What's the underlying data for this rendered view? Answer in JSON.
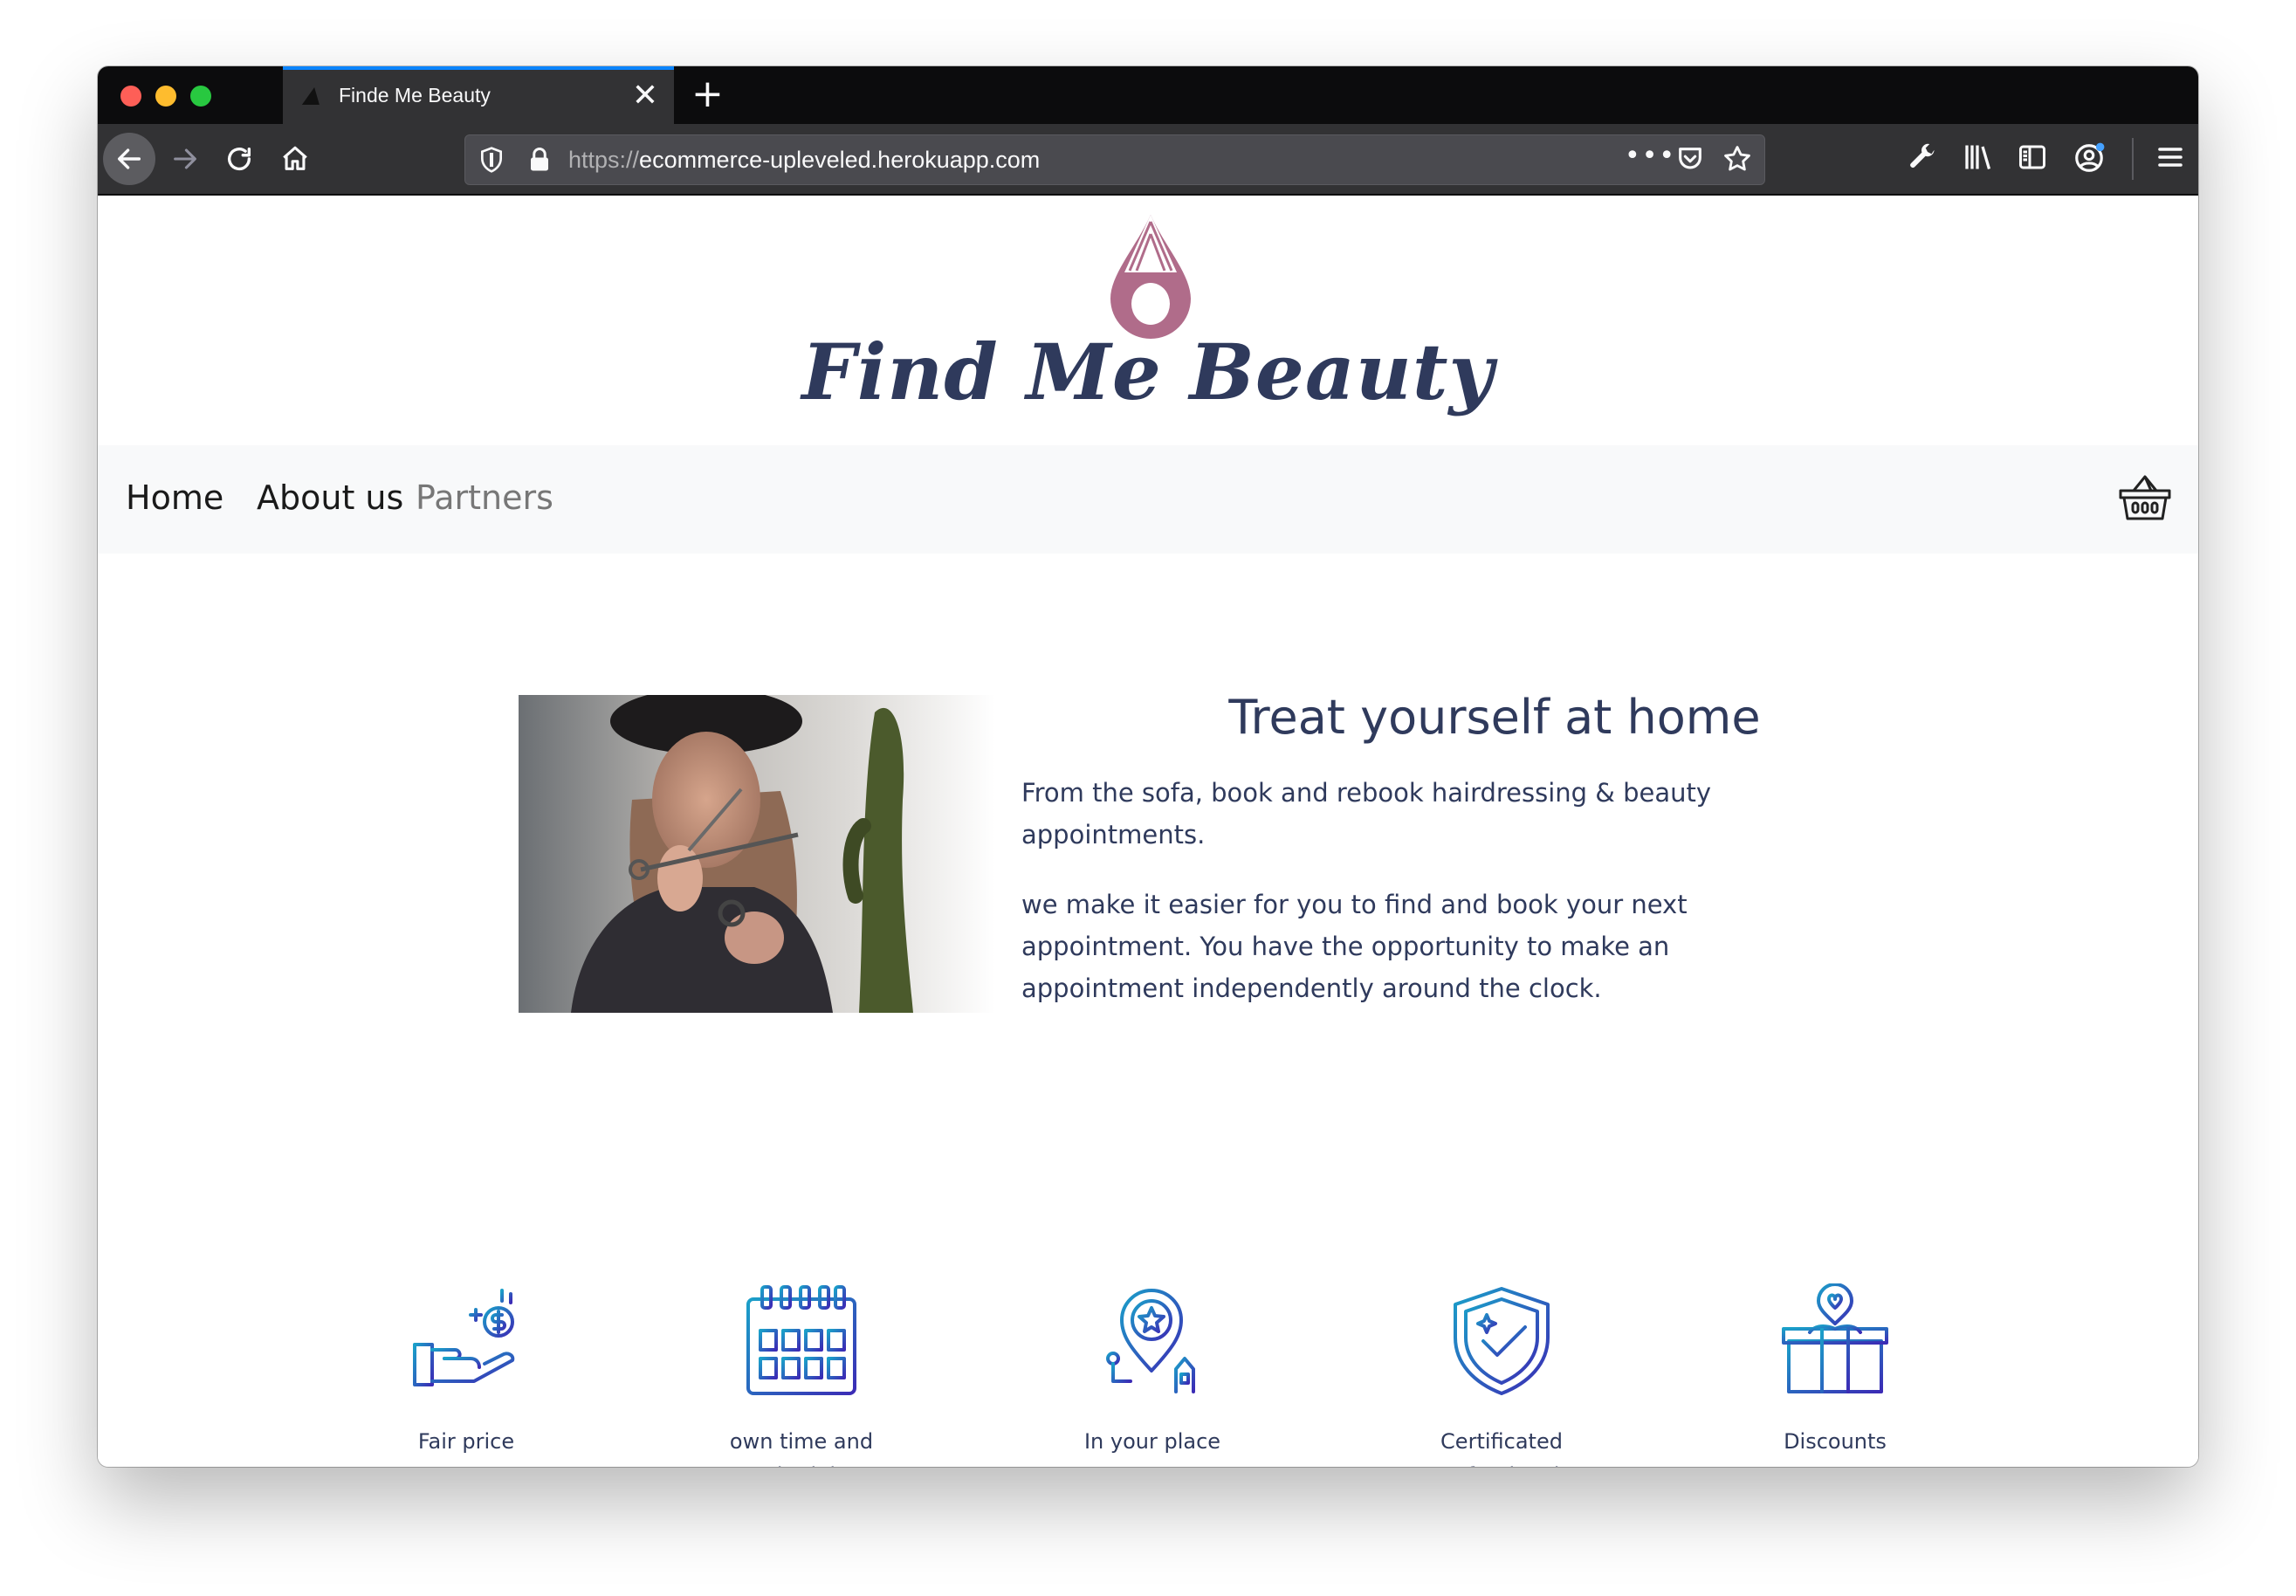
{
  "browser": {
    "tab_title": "Finde Me Beauty",
    "url_scheme": "https://",
    "url_host": "ecommerce-upleveled.herokuapp.com"
  },
  "site": {
    "brand": "Find Me Beauty",
    "accent_color": "#b06c8a",
    "text_color": "#2f3a5c",
    "icon_gradient": [
      "#1aa0c9",
      "#3b2bb5"
    ]
  },
  "nav": {
    "home": "Home",
    "about": "About us",
    "partners": "Partners"
  },
  "hero": {
    "title": "Treat yourself at home",
    "paragraph1": "From the sofa, book and rebook hairdressing & beauty appointments.",
    "paragraph2": "we make it easier for you to find and book your next appointment. You have the opportunity to make an appointment independently around the clock."
  },
  "features": [
    {
      "label": "Fair price",
      "icon": "hand-coin-icon"
    },
    {
      "label": "own time and schedule",
      "icon": "calendar-icon"
    },
    {
      "label": "In your place",
      "icon": "location-pin-icon"
    },
    {
      "label": "Certificated professionals",
      "icon": "shield-check-icon"
    },
    {
      "label": "Discounts",
      "icon": "gift-icon"
    }
  ]
}
